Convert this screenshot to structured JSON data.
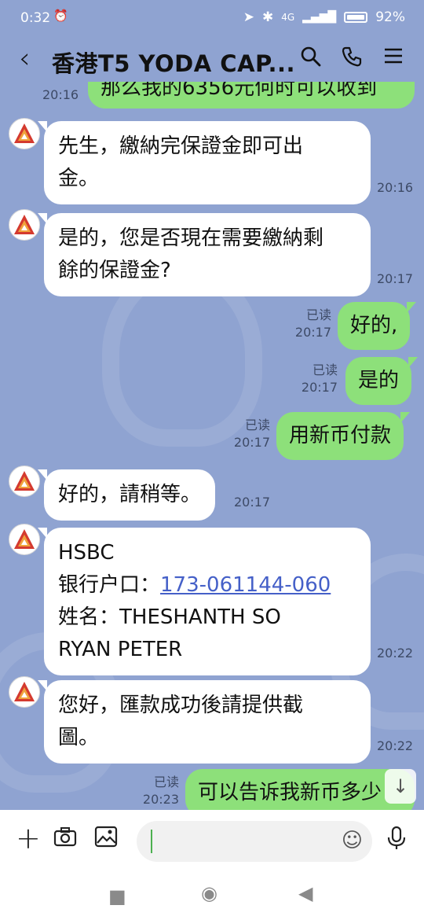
{
  "status_bar": {
    "time": "0:32",
    "network": "4G",
    "battery": "92%"
  },
  "header": {
    "back_icon": "chevron-left-icon",
    "title": "香港T5 YODA CAP..."
  },
  "messages": [
    {
      "side": "out",
      "text": "那么我的6356元何时可以收到",
      "time": "20:16"
    },
    {
      "side": "in",
      "lines": [
        "先生，繳納完保證金即可出",
        "金。"
      ],
      "time": "20:16"
    },
    {
      "side": "in",
      "lines": [
        "是的，您是否現在需要繳納剩",
        "餘的保證金?"
      ],
      "time": "20:17"
    },
    {
      "side": "out",
      "text": "好的,",
      "read": "已读",
      "time": "20:17"
    },
    {
      "side": "out",
      "text": "是的",
      "read": "已读",
      "time": "20:17"
    },
    {
      "side": "out",
      "text": "用新币付款",
      "read": "已读",
      "time": "20:17"
    },
    {
      "side": "in",
      "text": "好的，請稍等。",
      "time": "20:17"
    },
    {
      "side": "in",
      "bank": "HSBC",
      "account_label": "银行户口：",
      "account_number": "173-061144-060",
      "name_label": "姓名：",
      "name_line1": "THESHANTH SO",
      "name_line2": "RYAN PETER",
      "time": "20:22"
    },
    {
      "side": "in",
      "lines": [
        "您好，匯款成功後請提供截",
        "圖。"
      ],
      "time": "20:22"
    },
    {
      "side": "out",
      "text": "可以告诉我新币多少",
      "read": "已读",
      "time": "20:23"
    }
  ],
  "input": {
    "placeholder": "",
    "icons": [
      "plus-icon",
      "camera-icon",
      "image-icon",
      "emoji-icon",
      "microphone-icon"
    ]
  },
  "colors": {
    "chat_background": "#8fa3d1",
    "incoming_bubble": "#ffffff",
    "outgoing_bubble": "#8de07a",
    "link": "#4560c8"
  }
}
